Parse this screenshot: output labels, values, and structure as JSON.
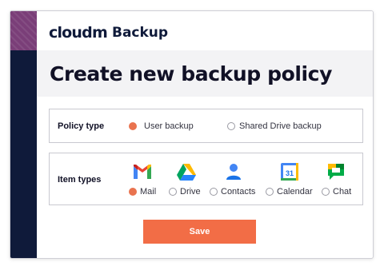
{
  "header": {
    "logo": "cloudm",
    "app_title": "Backup"
  },
  "page": {
    "title": "Create new backup policy"
  },
  "policy_type": {
    "label": "Policy type",
    "options": [
      {
        "label": "User backup",
        "selected": true
      },
      {
        "label": "Shared Drive backup",
        "selected": false
      }
    ]
  },
  "item_types": {
    "label": "Item types",
    "items": [
      {
        "label": "Mail",
        "icon": "gmail-icon",
        "selected": true
      },
      {
        "label": "Drive",
        "icon": "google-drive-icon",
        "selected": false
      },
      {
        "label": "Contacts",
        "icon": "contacts-icon",
        "selected": false
      },
      {
        "label": "Calendar",
        "icon": "calendar-icon",
        "selected": false,
        "icon_text": "31"
      },
      {
        "label": "Chat",
        "icon": "google-chat-icon",
        "selected": false
      }
    ]
  },
  "actions": {
    "save_label": "Save"
  },
  "colors": {
    "accent": "#f26d46",
    "sidebar": "#0f1a3a",
    "sidebar_top": "#7a3e78",
    "selected_radio": "#e9734f"
  }
}
